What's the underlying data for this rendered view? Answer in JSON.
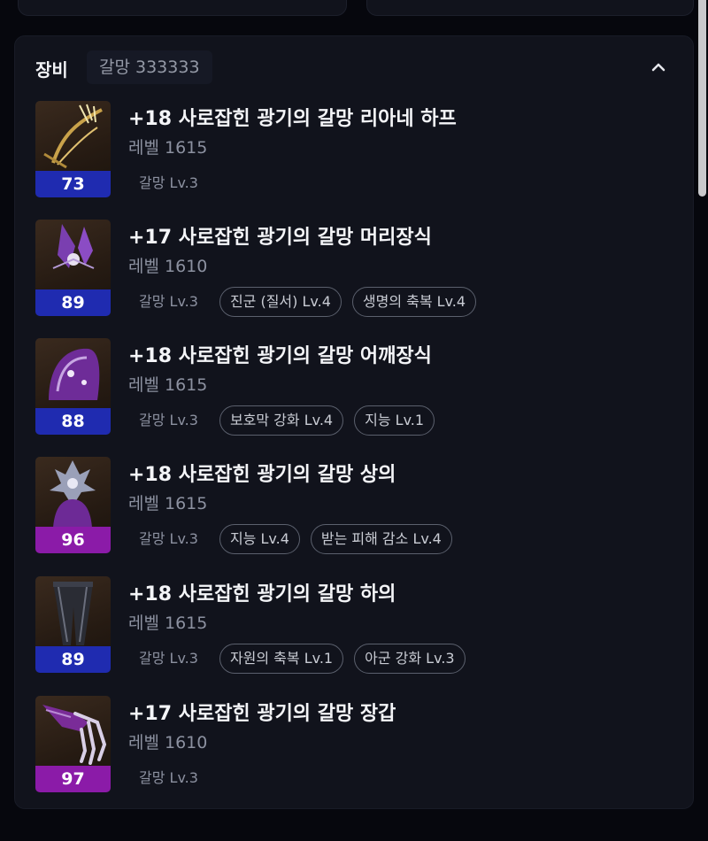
{
  "section": {
    "title": "장비",
    "summary": "갈망 333333"
  },
  "items": [
    {
      "name": "+18 사로잡힌 광기의 갈망 리아네 하프",
      "level": "레벨 1615",
      "quality": "73",
      "bar": "blue",
      "set": "갈망 Lv.3",
      "tags": [],
      "icon": "harp-icon"
    },
    {
      "name": "+17 사로잡힌 광기의 갈망 머리장식",
      "level": "레벨 1610",
      "quality": "89",
      "bar": "blue",
      "set": "갈망 Lv.3",
      "tags": [
        "진군 (질서) Lv.4",
        "생명의 축복 Lv.4"
      ],
      "icon": "headpiece-icon"
    },
    {
      "name": "+18 사로잡힌 광기의 갈망 어깨장식",
      "level": "레벨 1615",
      "quality": "88",
      "bar": "blue",
      "set": "갈망 Lv.3",
      "tags": [
        "보호막 강화 Lv.4",
        "지능 Lv.1"
      ],
      "icon": "shoulder-icon"
    },
    {
      "name": "+18 사로잡힌 광기의 갈망 상의",
      "level": "레벨 1615",
      "quality": "96",
      "bar": "purple",
      "set": "갈망 Lv.3",
      "tags": [
        "지능 Lv.4",
        "받는 피해 감소 Lv.4"
      ],
      "icon": "chest-armor-icon"
    },
    {
      "name": "+18 사로잡힌 광기의 갈망 하의",
      "level": "레벨 1615",
      "quality": "89",
      "bar": "blue",
      "set": "갈망 Lv.3",
      "tags": [
        "자원의 축복 Lv.1",
        "아군 강화 Lv.3"
      ],
      "icon": "pants-icon"
    },
    {
      "name": "+17 사로잡힌 광기의 갈망 장갑",
      "level": "레벨 1610",
      "quality": "97",
      "bar": "purple",
      "set": "갈망 Lv.3",
      "tags": [],
      "icon": "gloves-icon"
    }
  ],
  "colors": {
    "bar_blue": "#1f2bb0",
    "bar_purple": "#8b1ba8",
    "panel_bg": "#11131c"
  }
}
